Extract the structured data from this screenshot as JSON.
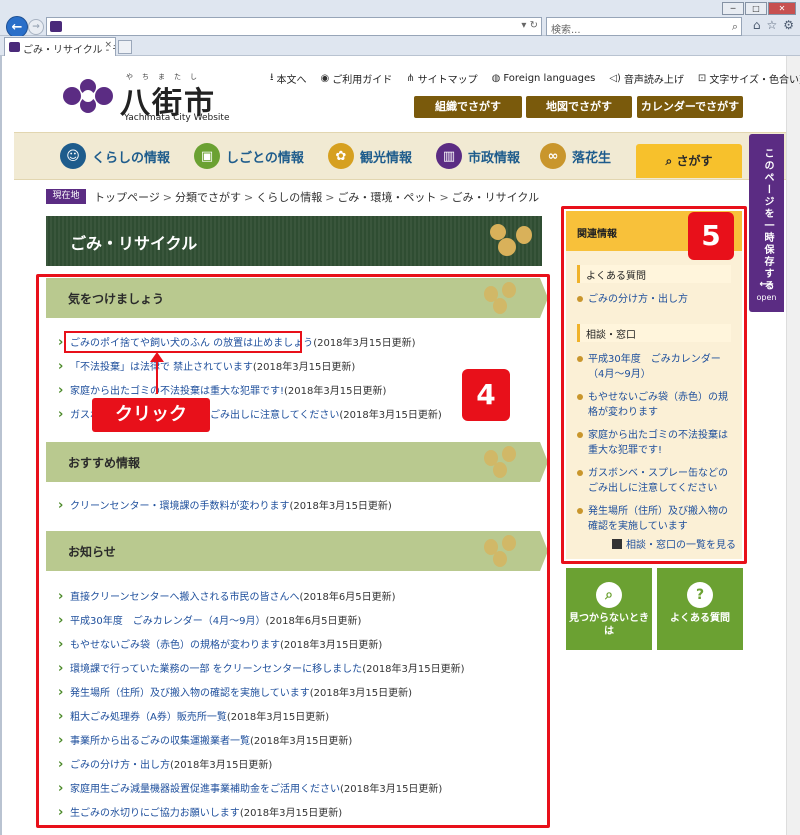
{
  "browser": {
    "tab_title": "ごみ・リサイクル - 千葉...",
    "search_placeholder": "検索...",
    "tab_close": "×"
  },
  "header": {
    "logo_jp": "八街市",
    "logo_ruby": "やちまたし",
    "logo_en": "Yachimata City Website",
    "util_links": [
      {
        "icon": "down-arrow-icon",
        "label": "本文へ"
      },
      {
        "icon": "guide-icon",
        "label": "ご利用ガイド"
      },
      {
        "icon": "sitemap-icon",
        "label": "サイトマップ"
      },
      {
        "icon": "globe-icon",
        "label": "Foreign languages"
      },
      {
        "icon": "speaker-icon",
        "label": "音声読み上げ"
      },
      {
        "icon": "font-size-icon",
        "label": "文字サイズ・色合い変更"
      }
    ],
    "buttons": [
      "組織でさがす",
      "地図でさがす",
      "カレンダーでさがす"
    ]
  },
  "gnav": {
    "items": [
      {
        "icon": "family-icon",
        "label": "くらしの情報",
        "color": "#1e5c8c"
      },
      {
        "icon": "briefcase-icon",
        "label": "しごとの情報",
        "color": "#1e5c8c"
      },
      {
        "icon": "flower-icon",
        "label": "観光情報",
        "color": "#1e5c8c"
      },
      {
        "icon": "city-hall-icon",
        "label": "市政情報",
        "color": "#1e5c8c"
      },
      {
        "icon": "peanut-icon",
        "label": "落花生",
        "color": "#1e5c8c"
      }
    ],
    "search": "さがす"
  },
  "save_tab": {
    "label": "このページを一時保存する",
    "open": "open"
  },
  "breadcrumb": {
    "label": "現在地",
    "items": [
      "トップページ",
      "分類でさがす",
      "くらしの情報",
      "ごみ・環境・ペット",
      "ごみ・リサイクル"
    ]
  },
  "page_title": "ごみ・リサイクル",
  "sections": [
    {
      "title": "気をつけましょう",
      "links": [
        {
          "text": "ごみのポイ捨てや飼い犬のふん の放置は止めましょう",
          "date": "(2018年3月15日更新)"
        },
        {
          "text": "「不法投棄」は法律で 禁止されています",
          "date": "(2018年3月15日更新)"
        },
        {
          "text": "家庭から出たゴミの不法投棄は重大な犯罪です!",
          "date": "(2018年3月15日更新)"
        },
        {
          "text": "ガスボンベ・スプレー缶などのごみ出しに注意してください",
          "date": "(2018年3月15日更新)"
        }
      ]
    },
    {
      "title": "おすすめ情報",
      "links": [
        {
          "text": "クリーンセンター・環境課の手数料が変わります",
          "date": "(2018年3月15日更新)"
        }
      ]
    },
    {
      "title": "お知らせ",
      "links": [
        {
          "text": "直接クリーンセンターへ搬入される市民の皆さんへ",
          "date": "(2018年6月5日更新)"
        },
        {
          "text": "平成30年度　ごみカレンダー（4月～9月）",
          "date": "(2018年6月5日更新)"
        },
        {
          "text": "もやせないごみ袋（赤色）の規格が変わります",
          "date": "(2018年3月15日更新)"
        },
        {
          "text": "環境課で行っていた業務の一部 をクリーンセンターに移しました",
          "date": "(2018年3月15日更新)"
        },
        {
          "text": "発生場所（住所）及び搬入物の確認を実施しています",
          "date": "(2018年3月15日更新)"
        },
        {
          "text": "粗大ごみ処理券（A券）販売所一覧",
          "date": "(2018年3月15日更新)"
        },
        {
          "text": "事業所から出るごみの収集運搬業者一覧",
          "date": "(2018年3月15日更新)"
        },
        {
          "text": "ごみの分け方・出し方",
          "date": "(2018年3月15日更新)"
        },
        {
          "text": "家庭用生ごみ減量機器設置促進事業補助金をご活用ください",
          "date": "(2018年3月15日更新)"
        },
        {
          "text": "生ごみの水切りにご協力お願いします",
          "date": "(2018年3月15日更新)"
        }
      ]
    }
  ],
  "annotations": {
    "click_label": "クリック",
    "badge_main": "4",
    "badge_side": "5",
    "accent_color": "#e8101a"
  },
  "sidebar": {
    "title": "関連情報",
    "groups": [
      {
        "title": "よくある質問",
        "items": [
          "ごみの分け方・出し方"
        ]
      },
      {
        "title": "相談・窓口",
        "items": [
          "平成30年度　ごみカレンダー（4月～9月）",
          "もやせないごみ袋（赤色）の規格が変わります",
          "家庭から出たゴミの不法投棄は重大な犯罪です!",
          "ガスボンベ・スプレー缶などのごみ出しに注意してください",
          "発生場所（住所）及び搬入物の確認を実施しています"
        ]
      }
    ],
    "more": "相談・窓口の一覧を見る",
    "buttons": [
      {
        "icon": "magnifier-icon",
        "label": "見つからないときは"
      },
      {
        "icon": "question-icon",
        "label": "よくある質問"
      }
    ]
  }
}
